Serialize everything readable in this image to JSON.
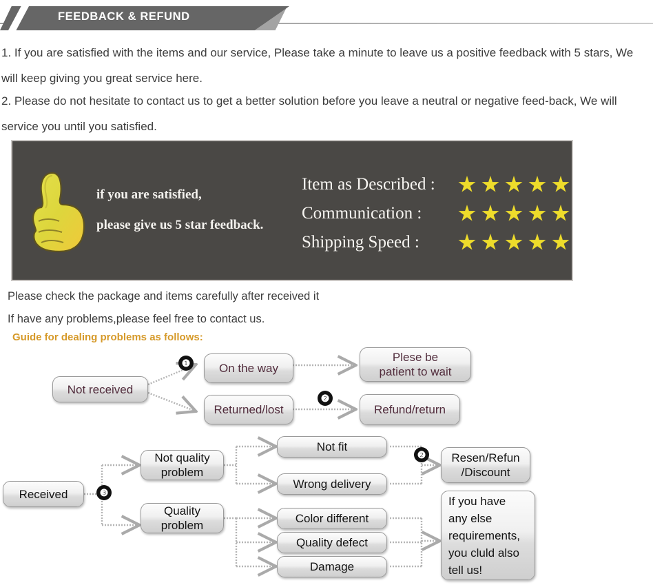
{
  "header": {
    "title": "FEEDBACK & REFUND"
  },
  "intro": {
    "paragraph1": "1. If you are satisfied with the items and our service, Please take a minute to leave us a positive feedback with 5 stars, We will keep giving you great service here.",
    "paragraph2": "2. Please do not hesitate to contact us to get a better solution before you leave a neutral or negative feed-back, We will service you until you satisfied."
  },
  "banner": {
    "caption_line1": "if you are satisfied,",
    "caption_line2": "please give us 5 star feedback.",
    "ratings": [
      {
        "label": "Item as Described :",
        "stars": 5
      },
      {
        "label": "Communication :",
        "stars": 5
      },
      {
        "label": "Shipping Speed :",
        "stars": 5
      }
    ]
  },
  "notes": {
    "line1": "Please check the package and items carefully after received it",
    "line2": "If have any problems,please feel free to contact us.",
    "guide_heading": "Guide for dealing problems as follows:"
  },
  "flow_top": {
    "badge1": "❶",
    "badge2": "❷",
    "nodes": {
      "not_received": "Not received",
      "on_the_way": "On the way",
      "returned_lost": "Returned/lost",
      "please_wait": "Plese be\npatient to wait",
      "refund_return": "Refund/return"
    }
  },
  "flow_bottom": {
    "badge3": "❸",
    "badge2": "❷",
    "nodes": {
      "received": "Received",
      "not_quality_problem": "Not quality\nproblem",
      "quality_problem": "Quality\nproblem",
      "not_fit": "Not fit",
      "wrong_delivery": "Wrong delivery",
      "color_different": "Color different",
      "quality_defect": "Quality defect",
      "damage": "Damage",
      "resend_refund_discount": "Resen/Refun\n/Discount",
      "any_else": "If you have\nany else\nrequirements,\nyou cluld also\ntell us!"
    }
  },
  "colors": {
    "header_band": "#666666",
    "banner_bg": "#4a4845",
    "star": "#eedc2b",
    "guide_text": "#d69a2a",
    "plum_text": "#512c3c"
  }
}
